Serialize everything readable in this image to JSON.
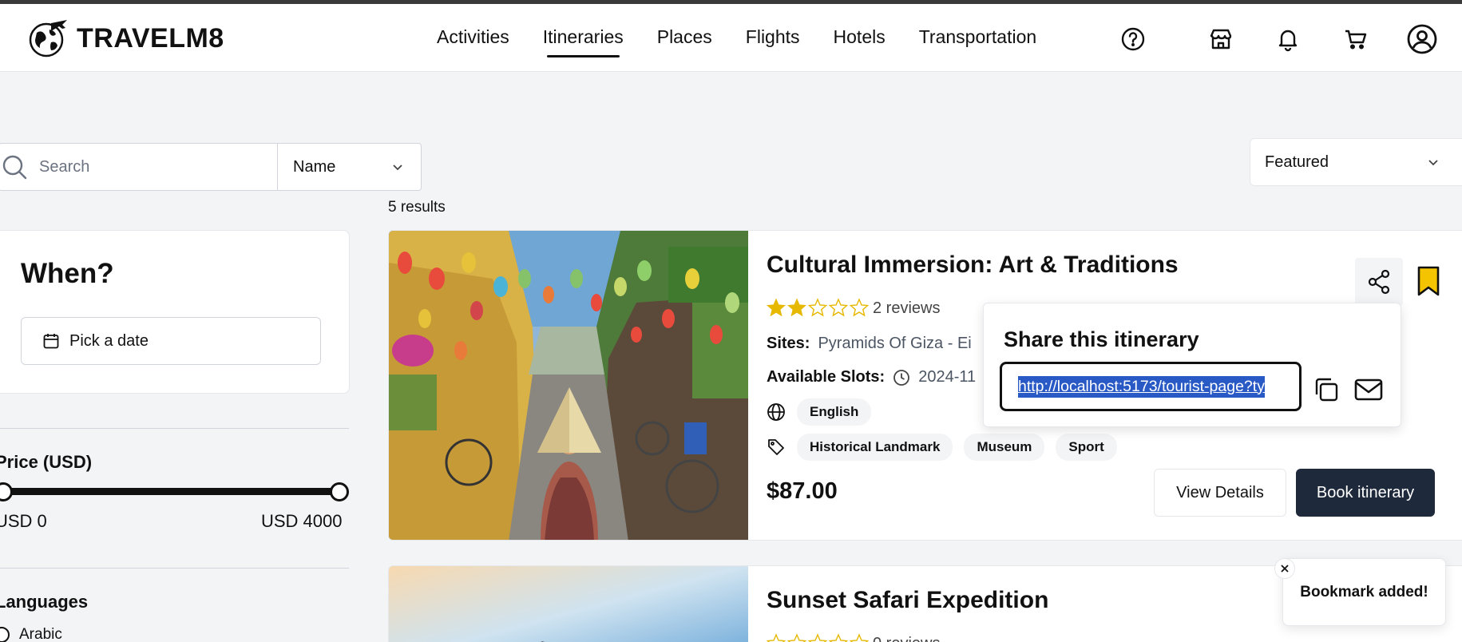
{
  "app": {
    "brand": "TRAVELM8"
  },
  "nav": {
    "items": [
      {
        "label": "Activities"
      },
      {
        "label": "Itineraries"
      },
      {
        "label": "Places"
      },
      {
        "label": "Flights"
      },
      {
        "label": "Hotels"
      },
      {
        "label": "Transportation"
      }
    ],
    "active": "Itineraries"
  },
  "header_icons": [
    "help-icon",
    "store-icon",
    "bell-icon",
    "cart-icon",
    "user-icon"
  ],
  "search": {
    "placeholder": "Search",
    "value": ""
  },
  "filter_by": {
    "selected": "Name"
  },
  "sort": {
    "selected": "Featured"
  },
  "results_text": "5 results",
  "sidebar": {
    "when_title": "When?",
    "date_button": "Pick a date",
    "price_title": "Price (USD)",
    "price_min": "USD 0",
    "price_max": "USD 4000",
    "languages_title": "Languages",
    "language_options": [
      "Arabic"
    ]
  },
  "itineraries": [
    {
      "title": "Cultural Immersion: Art & Traditions",
      "rating": 2,
      "reviews": "2 reviews",
      "sites_label": "Sites:",
      "sites_value": "Pyramids Of Giza - Ei",
      "slots_label": "Available Slots:",
      "slots_value": "2024-11",
      "language": "English",
      "tags": [
        "Historical Landmark",
        "Museum",
        "Sport"
      ],
      "price": "$87.00",
      "view_label": "View Details",
      "book_label": "Book itinerary",
      "bookmarked": true
    },
    {
      "title": "Sunset Safari Expedition",
      "rating": 0,
      "reviews": "0 reviews"
    }
  ],
  "share_popover": {
    "title": "Share this itinerary",
    "url": "http://localhost:5173/tourist-page?ty"
  },
  "toast": {
    "message": "Bookmark added!"
  },
  "colors": {
    "accent_dark": "#1e293b",
    "star": "#e6b800",
    "bookmark": "#f5c400",
    "selection": "#2859c5",
    "page_bg": "#f3f4f6"
  }
}
